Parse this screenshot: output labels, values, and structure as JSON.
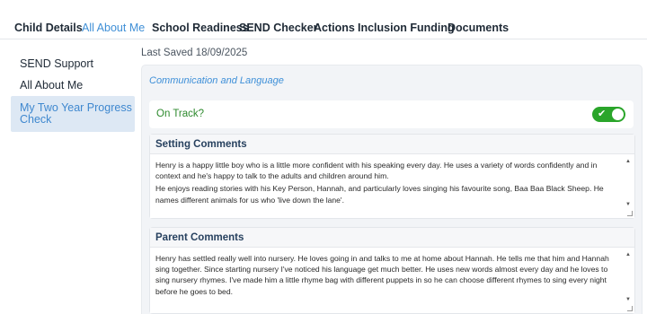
{
  "tabs": [
    {
      "label": "Child Details"
    },
    {
      "label": "All About Me"
    },
    {
      "label": "School Readiness"
    },
    {
      "label": "SEND Checker"
    },
    {
      "label": "Actions"
    },
    {
      "label": "Inclusion Funding"
    },
    {
      "label": "Documents"
    }
  ],
  "active_tab": "All About Me",
  "sidebar": {
    "items": [
      {
        "label": "SEND Support"
      },
      {
        "label": "All About Me"
      },
      {
        "label": "My Two Year Progress Check"
      }
    ],
    "active_item": "My Two Year Progress Check"
  },
  "last_saved": "Last Saved 18/09/2025",
  "section": {
    "title": "Communication and Language",
    "on_track_label": "On Track?",
    "on_track": true,
    "setting_comments": {
      "title": "Setting Comments",
      "paragraphs": [
        "Henry is a happy little boy who is a little more confident with his speaking every day. He uses a variety of words confidently and in context and he's happy to talk to the adults and children around him.",
        "He enjoys reading stories with his Key Person, Hannah, and particularly loves singing his favourite song, Baa Baa Black Sheep. He names different animals for us who 'live down the lane'."
      ]
    },
    "parent_comments": {
      "title": "Parent Comments",
      "text": "Henry has settled really well into nursery. He loves going in and talks to me at home about Hannah. He tells me that him and Hannah sing together. Since starting nursery I've noticed his language get much better. He uses new words almost every day and he loves to sing nursery rhymes. I've made him a little rhyme bag with different puppets in so he can choose different rhymes to sing every night before he goes to bed."
    }
  },
  "colors": {
    "accent": "#3f8fd6",
    "toggle_on": "#2aa52a",
    "on_track_text": "#2e8a2e",
    "sidebar_active_bg": "#dde8f4"
  }
}
